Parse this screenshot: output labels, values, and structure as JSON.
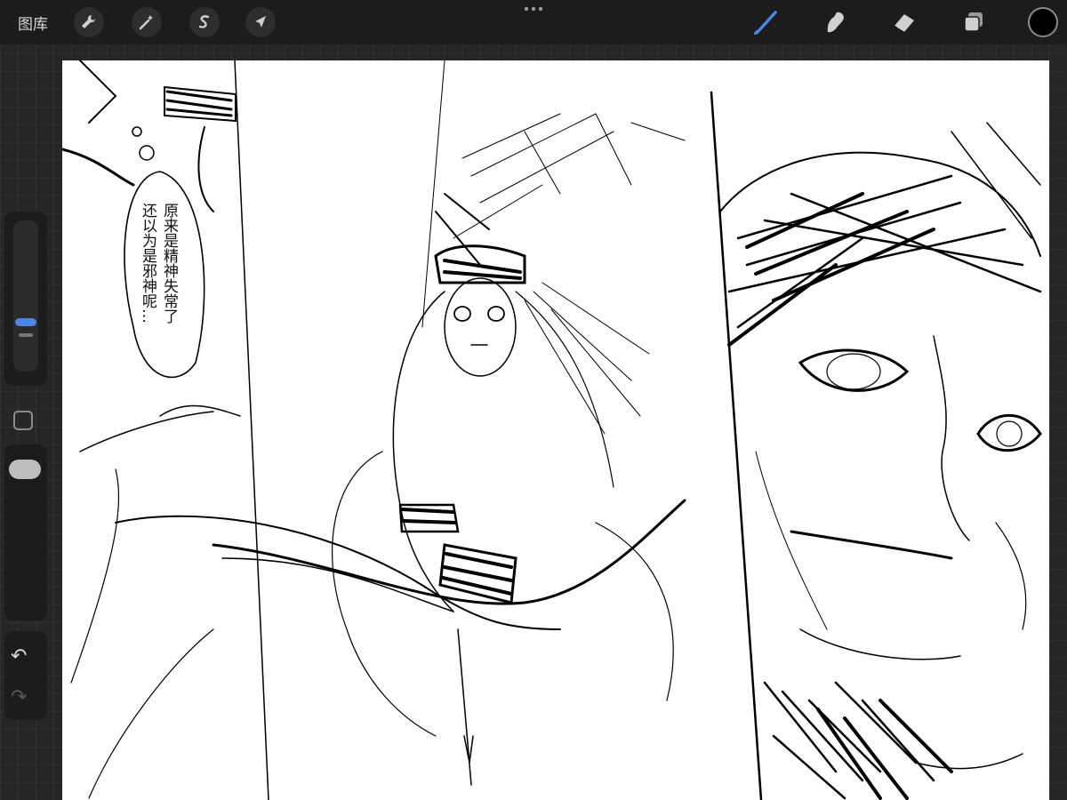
{
  "toolbar": {
    "gallery_label": "图库",
    "left_tools": [
      "wrench-icon",
      "magic-wand-icon",
      "selection-icon",
      "transform-arrow-icon"
    ],
    "right_tools": [
      "brush-icon",
      "smudge-icon",
      "eraser-icon",
      "layers-icon"
    ],
    "active_tool": "brush-icon",
    "accent_color": "#4a86e8",
    "current_color": "#000000"
  },
  "sidebar": {
    "items": [
      "brush-size-slider",
      "modify-button",
      "opacity-slider",
      "undo-button",
      "redo-button"
    ],
    "undo_glyph": "↶",
    "redo_glyph": "↷"
  },
  "canvas": {
    "speech_bubble_lines": [
      "原来是精神失常了",
      "还以为是邪神呢…"
    ]
  }
}
